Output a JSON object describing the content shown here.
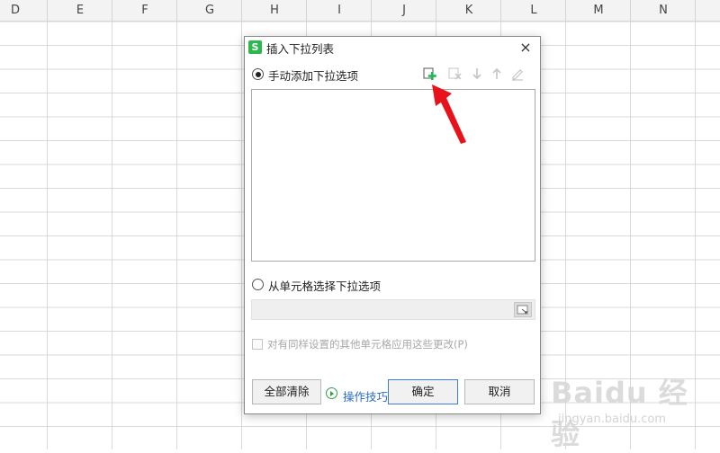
{
  "spreadsheet": {
    "columns": [
      "D",
      "E",
      "F",
      "G",
      "H",
      "I",
      "J",
      "K",
      "L",
      "M",
      "N"
    ]
  },
  "dialog": {
    "title": "插入下拉列表",
    "close_label": "×",
    "option_manual": "手动添加下拉选项",
    "option_from_cells": "从单元格选择下拉选项",
    "apply_all_label": "对有同样设置的其他单元格应用这些更改(P)",
    "clear_all_button": "全部清除",
    "tips_link": "操作技巧",
    "ok_button": "确定",
    "cancel_button": "取消",
    "toolbar_icons": [
      "add-item-icon",
      "delete-item-icon",
      "move-down-icon",
      "move-up-icon",
      "edit-icon"
    ],
    "accent_colors": {
      "add": "#1db954",
      "link": "#2b6cc4",
      "arrow": "#e8121b"
    }
  },
  "watermark": {
    "brand": "Baidu 经验",
    "url": "jingyan.baidu.com"
  }
}
